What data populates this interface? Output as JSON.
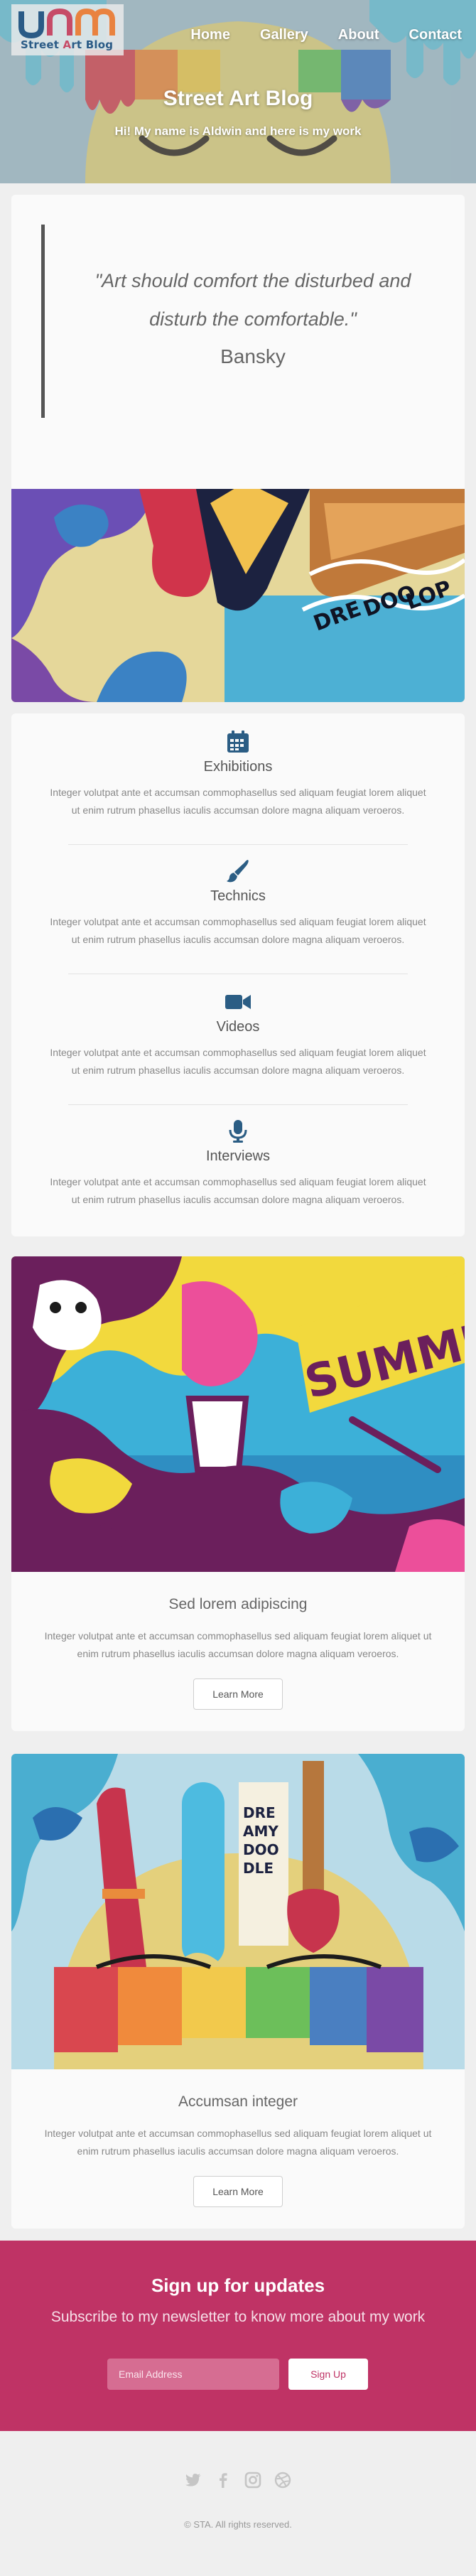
{
  "header": {
    "logo_text_part1": "Street ",
    "logo_text_highlight": "A",
    "logo_text_part2": "rt Blog",
    "nav": [
      "Home",
      "Gallery",
      "About",
      "Contact"
    ],
    "title": "Street Art Blog",
    "subtitle": "Hi! My name is Aldwin and here is my work"
  },
  "quote": {
    "text_line1": "\"Art should comfort the disturbed and",
    "text_line2": "disturb the comfortable.\"",
    "author": "Bansky"
  },
  "features": [
    {
      "icon": "calendar-icon",
      "title": "Exhibitions",
      "description": "Integer volutpat ante et accumsan commophasellus sed aliquam feugiat lorem aliquet ut enim rutrum phasellus iaculis accumsan dolore magna aliquam veroeros."
    },
    {
      "icon": "paintbrush-icon",
      "title": "Technics",
      "description": "Integer volutpat ante et accumsan commophasellus sed aliquam feugiat lorem aliquet ut enim rutrum phasellus iaculis accumsan dolore magna aliquam veroeros."
    },
    {
      "icon": "video-camera-icon",
      "title": "Videos",
      "description": "Integer volutpat ante et accumsan commophasellus sed aliquam feugiat lorem aliquet ut enim rutrum phasellus iaculis accumsan dolore magna aliquam veroeros."
    },
    {
      "icon": "microphone-icon",
      "title": "Interviews",
      "description": "Integer volutpat ante et accumsan commophasellus sed aliquam feugiat lorem aliquet ut enim rutrum phasellus iaculis accumsan dolore magna aliquam veroeros."
    }
  ],
  "articles": [
    {
      "title": "Sed lorem adipiscing",
      "description": "Integer volutpat ante et accumsan commophasellus sed aliquam feugiat lorem aliquet ut enim rutrum phasellus iaculis accumsan dolore magna aliquam veroeros.",
      "button": "Learn More"
    },
    {
      "title": "Accumsan integer",
      "description": "Integer volutpat ante et accumsan commophasellus sed aliquam feugiat lorem aliquet ut enim rutrum phasellus iaculis accumsan dolore magna aliquam veroeros.",
      "button": "Learn More"
    }
  ],
  "signup": {
    "title": "Sign up for updates",
    "subtitle": "Subscribe to my newsletter to know more about my work",
    "email_placeholder": "Email Address",
    "button": "Sign Up"
  },
  "footer": {
    "social_icons": [
      "twitter-icon",
      "facebook-icon",
      "instagram-icon",
      "dribbble-icon"
    ],
    "copyright": "© STA. All rights reserved."
  },
  "colors": {
    "accent": "#bf3365",
    "icon_blue": "#2b5d84",
    "text": "#555555"
  }
}
